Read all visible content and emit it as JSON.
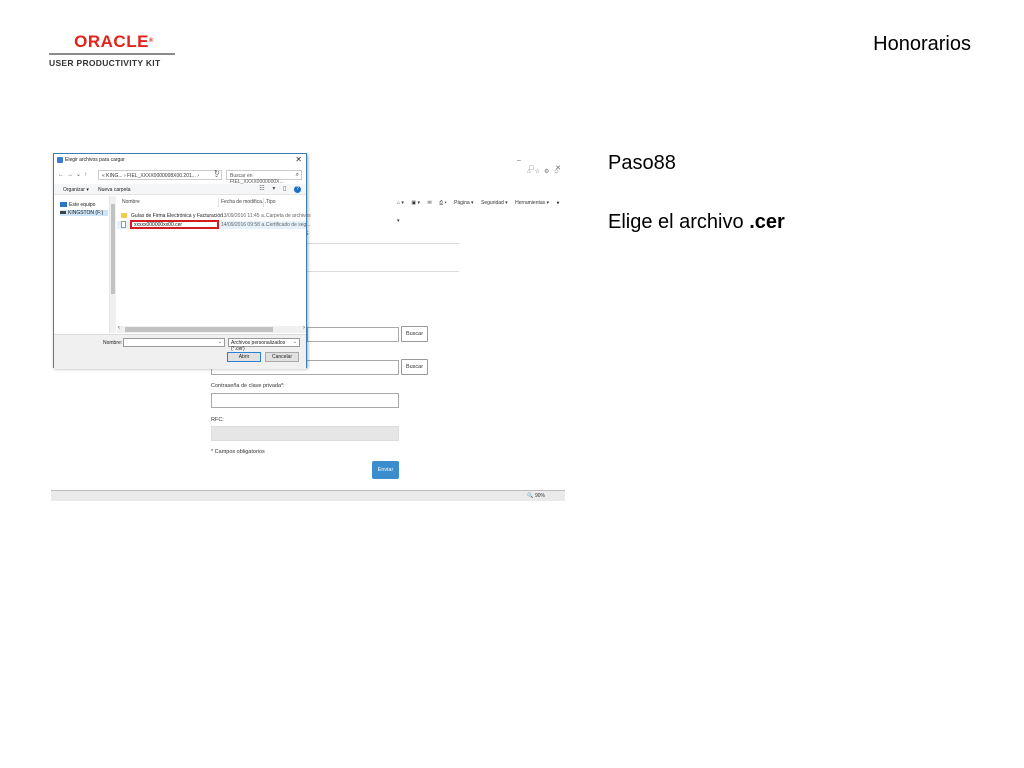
{
  "brand": {
    "name": "ORACLE",
    "reg": "®",
    "subtitle": "USER PRODUCTIVITY KIT"
  },
  "page_title": "Honorarios",
  "step": "Paso88",
  "instruction": {
    "prefix": "Elige el archivo ",
    "emphasis": ".cer"
  },
  "screenshot": {
    "ie_toolbar": {
      "page": "Página ▾",
      "security": "Seguridad ▾",
      "tools": "Herramientas ▾"
    },
    "form": {
      "label_fragment": "E",
      "buscar_1": "Buscar",
      "buscar_2": "Buscar",
      "password_label": "Contraseña de clave privada*:",
      "rfc_label": "RFC:",
      "required_note": "* Campos obligatorios",
      "send_button": "Enviar"
    },
    "status_zoom": "90%",
    "dialog": {
      "title": "Elegir archivos para cargar",
      "address_path": "« KING... › FIEL_XXXX0000008X00.201... ›",
      "search_placeholder": "Buscar en FIEL_XXXX0000000X...",
      "organize": "Organizar ▾",
      "new_folder": "Nueva carpeta",
      "nav_items": [
        "Este equipo",
        "KINGSTON (F:)"
      ],
      "columns": [
        "Nombre",
        "Fecha de modifica...",
        "Tipo"
      ],
      "rows": [
        {
          "name": "Guías de Firma Electrónica y Facturación",
          "date": "13/09/2016 11:45 a...",
          "type": "Carpeta de archivos"
        },
        {
          "name": "xxxxx000000xx00.cer",
          "date": "14/09/2016 09:58 a...",
          "type": "Certificado de seg..."
        }
      ],
      "filename_label": "Nombre:",
      "filename_value": "",
      "filter": "Archivos personalizados (*.cer)",
      "open_button": "Abrir",
      "cancel_button": "Cancelar"
    }
  }
}
